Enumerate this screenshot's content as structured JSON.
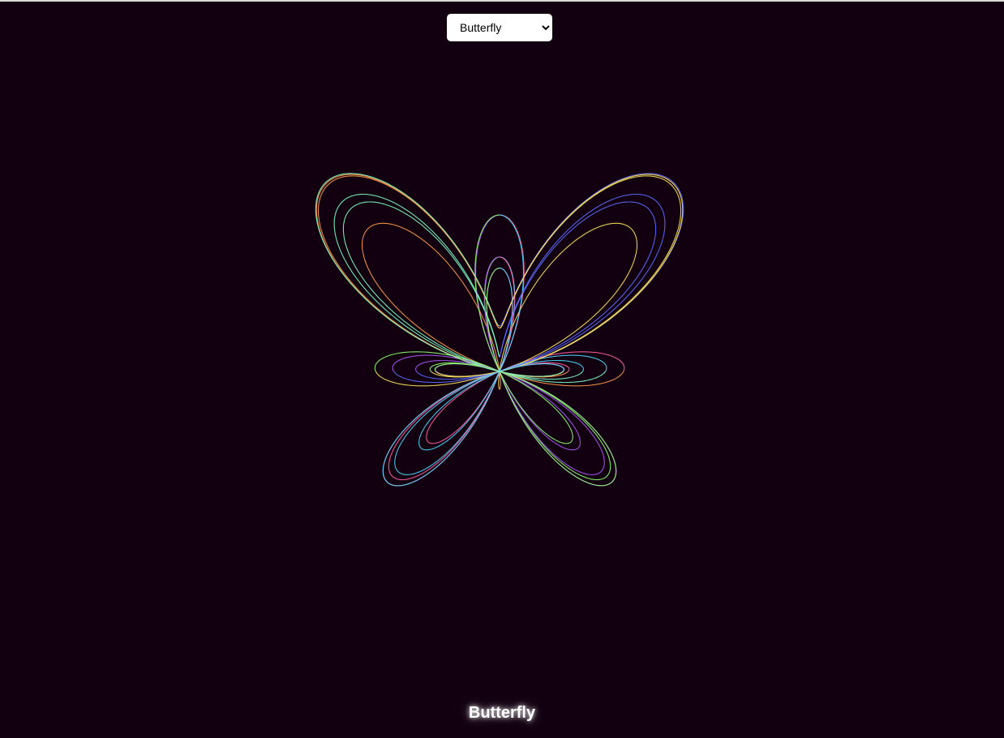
{
  "selector": {
    "selected": "Butterfly",
    "options": [
      "Butterfly"
    ]
  },
  "caption": "Butterfly",
  "curve": {
    "name": "Butterfly",
    "colors": [
      "#5b6cff",
      "#a855f7",
      "#ff5fa2",
      "#ff9a4a",
      "#ffe45c",
      "#8cff6b",
      "#4dd9ff",
      "#7cffc4"
    ]
  }
}
